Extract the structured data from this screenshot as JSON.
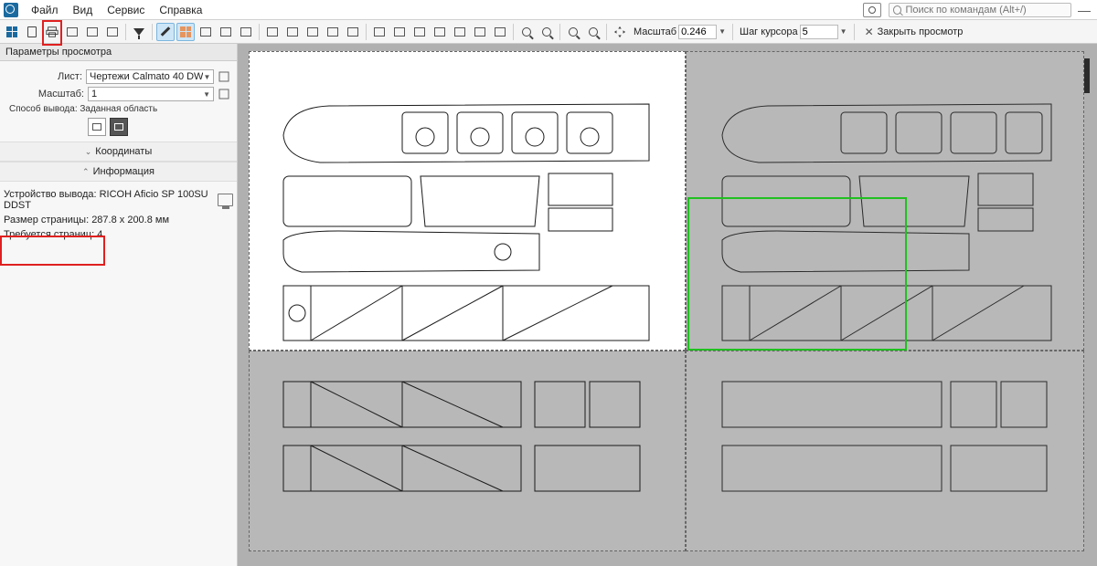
{
  "menu": {
    "items": [
      "Файл",
      "Вид",
      "Сервис",
      "Справка"
    ]
  },
  "search": {
    "placeholder": "Поиск по командам (Alt+/)"
  },
  "toolbar": {
    "scale_label": "Масштаб",
    "scale_value": "0.246",
    "cursor_label": "Шаг курсора",
    "cursor_value": "5",
    "close_preview": "Закрыть просмотр"
  },
  "panel": {
    "title": "Параметры просмотра",
    "sheet_label": "Лист:",
    "sheet_value": "Чертежи Calmato 40 DW",
    "scale_label": "Масштаб:",
    "scale_value": "1",
    "method_label": "Способ вывода: Заданная область",
    "coords_section": "Координаты",
    "info_section": "Информация",
    "device_label": "Устройство вывода:",
    "device_value": "RICOH Aficio SP 100SU DDST",
    "pagesize_label": "Размер страницы:",
    "pagesize_value": "287.8 x 200.8 мм",
    "pages_label": "Требуется страниц:",
    "pages_value": "4"
  }
}
